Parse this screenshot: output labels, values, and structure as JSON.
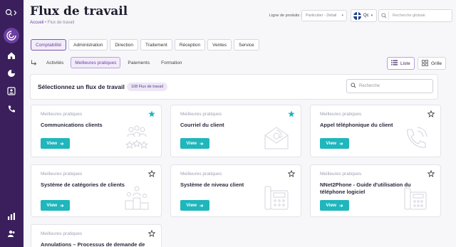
{
  "header": {
    "title": "Flux de travail",
    "breadcrumb": {
      "home": "Accueil",
      "separator": "•",
      "current": "Flux de travail"
    },
    "product_line": {
      "label": "Ligne de produits :",
      "value": "Particulier - Détail"
    },
    "language": {
      "value": "Qc"
    },
    "global_search": {
      "placeholder": "Recherche globale"
    }
  },
  "departments": [
    "Comptabilité",
    "Administration",
    "Direction",
    "Traitement",
    "Réception",
    "Ventes",
    "Service"
  ],
  "subtabs": [
    "Activités",
    "Meilleures pratiques",
    "Paiements",
    "Formation"
  ],
  "view_toggle": {
    "list": "Liste",
    "grid": "Grille"
  },
  "selector": {
    "title": "Sélectionnez un flux de travail",
    "count": "108 Flux de travail",
    "search_placeholder": "Recherche"
  },
  "cards": [
    {
      "kind": "Meilleures pratiques",
      "name": "Communications clients",
      "starred": true,
      "button": "View"
    },
    {
      "kind": "Meilleures pratiques",
      "name": "Courriel du client",
      "starred": true,
      "button": "View"
    },
    {
      "kind": "Meilleures pratiques",
      "name": "Appel téléphonique du client",
      "starred": false,
      "button": "View"
    },
    {
      "kind": "Meilleures pratiques",
      "name": "Système de catégories de clients",
      "starred": false,
      "button": "View"
    },
    {
      "kind": "Meilleures pratiques",
      "name": "Système de niveau client",
      "starred": false,
      "button": "View"
    },
    {
      "kind": "Meilleures pratiques",
      "name": "NNet2Phone - Guide d'utilisation du téléphone logiciel",
      "starred": false,
      "button": "View"
    },
    {
      "kind": "Meilleures pratiques",
      "name": "Annulations – Processus de demande de",
      "starred": false,
      "button": "View"
    }
  ],
  "colors": {
    "sidebar": "#3a1f5c",
    "accent": "#6c3fa3",
    "teal": "#1fb6bc"
  }
}
